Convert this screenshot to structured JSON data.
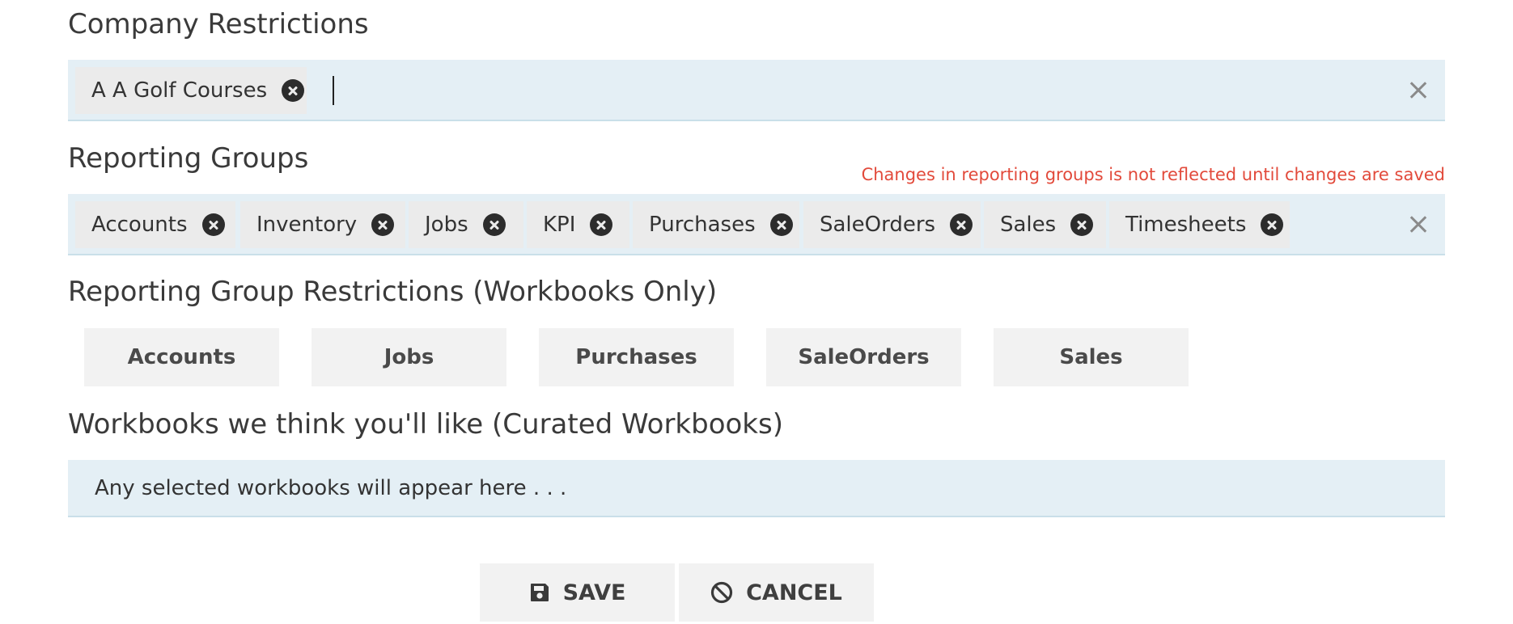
{
  "company_restrictions": {
    "title": "Company Restrictions",
    "chips": [
      "A A Golf Courses"
    ]
  },
  "reporting_groups": {
    "title": "Reporting Groups",
    "warning": "Changes in reporting groups is not reflected until changes are saved",
    "chips": [
      "Accounts",
      "Inventory",
      "Jobs",
      "KPI",
      "Purchases",
      "SaleOrders",
      "Sales",
      "Timesheets"
    ]
  },
  "reporting_group_restrictions": {
    "title": "Reporting Group Restrictions (Workbooks Only)",
    "buttons": [
      "Accounts",
      "Jobs",
      "Purchases",
      "SaleOrders",
      "Sales"
    ]
  },
  "curated_workbooks": {
    "title": "Workbooks we think you'll like (Curated Workbooks)",
    "placeholder": "Any selected workbooks will appear here . . ."
  },
  "actions": {
    "save_label": "SAVE",
    "cancel_label": "CANCEL",
    "save_icon": "floppy-disk-icon",
    "cancel_icon": "ban-icon"
  },
  "colors": {
    "tag_box_bg": "#e4eff5",
    "warning": "#e24a3b",
    "chip_bg": "#ebebeb"
  }
}
